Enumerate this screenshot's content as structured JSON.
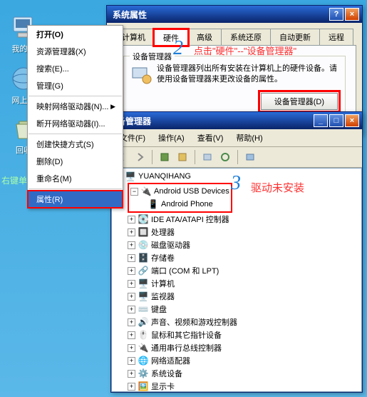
{
  "desktop": {
    "icons": [
      {
        "label": "我的电",
        "name": "my-computer"
      },
      {
        "label": "网上邻",
        "name": "network-places"
      },
      {
        "label": "回收",
        "name": "recycle-bin"
      }
    ]
  },
  "context_menu": {
    "title": "打开(O)",
    "items": [
      {
        "label": "资源管理器(X)",
        "sep": false
      },
      {
        "label": "搜索(E)...",
        "sep": false
      },
      {
        "label": "管理(G)",
        "sep": true
      },
      {
        "label": "映射网络驱动器(N)...",
        "sep": false
      },
      {
        "label": "断开网络驱动器(I)...",
        "sep": true
      },
      {
        "label": "创建快捷方式(S)",
        "sep": false
      },
      {
        "label": "删除(D)",
        "sep": false
      },
      {
        "label": "重命名(M)",
        "sep": true
      },
      {
        "label": "属性(R)",
        "selected": true
      }
    ]
  },
  "sysprop": {
    "title": "系统属性",
    "tabs": [
      "计算机",
      "硬件",
      "高级",
      "系统还原",
      "自动更新",
      "远程"
    ],
    "active_tab": "硬件",
    "group_title": "设备管理器",
    "group_desc": "设备管理器列出所有安装在计算机上的硬件设备。请使用设备管理器来更改设备的属性。",
    "btn_devmgr": "设备管理器(D)"
  },
  "devmgr": {
    "title": "备管理器",
    "menus": [
      "文件(F)",
      "操作(A)",
      "查看(V)",
      "帮助(H)"
    ],
    "root": "YUANQIHANG",
    "android_group": "Android USB Devices",
    "android_child": "Android Phone",
    "nodes": [
      {
        "label": "IDE ATA/ATAPI 控制器",
        "icon": "ide"
      },
      {
        "label": "处理器",
        "icon": "cpu"
      },
      {
        "label": "磁盘驱动器",
        "icon": "disk"
      },
      {
        "label": "存储卷",
        "icon": "storage"
      },
      {
        "label": "端口 (COM 和 LPT)",
        "icon": "port"
      },
      {
        "label": "计算机",
        "icon": "computer"
      },
      {
        "label": "监视器",
        "icon": "monitor"
      },
      {
        "label": "键盘",
        "icon": "keyboard"
      },
      {
        "label": "声音、视频和游戏控制器",
        "icon": "sound"
      },
      {
        "label": "鼠标和其它指针设备",
        "icon": "mouse"
      },
      {
        "label": "通用串行总线控制器",
        "icon": "usb"
      },
      {
        "label": "网络适配器",
        "icon": "network"
      },
      {
        "label": "系统设备",
        "icon": "system"
      },
      {
        "label": "显示卡",
        "icon": "display"
      }
    ]
  },
  "annotations": {
    "num2": "2",
    "num3": "3",
    "hint2": "点击\"硬件\"--\"设备管理器\"",
    "hint3": "驱动未安装",
    "instruction": "右键单击 \"我的电脑-属性\""
  }
}
